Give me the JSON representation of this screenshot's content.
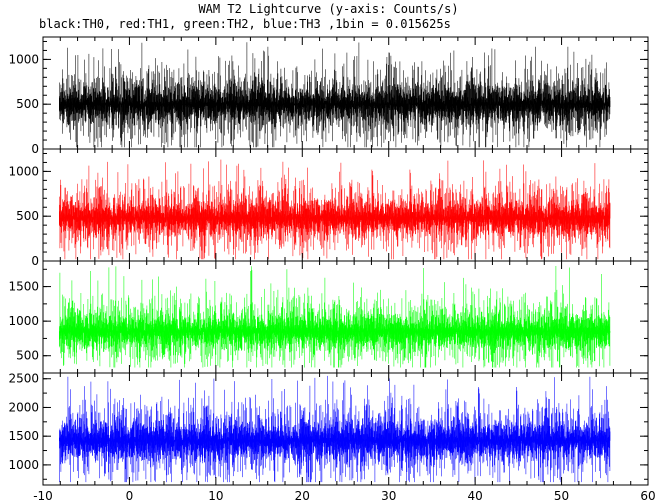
{
  "chart_data": {
    "type": "line",
    "title": "WAM T2 Lightcurve (y-axis: Counts/s)",
    "subtitle": "black:TH0, red:TH1, green:TH2, blue:TH3 ,1bin = 0.015625s",
    "xlim": [
      -10,
      60
    ],
    "x_ticks": [
      -10,
      0,
      10,
      20,
      30,
      40,
      50,
      60
    ],
    "x_data_range": [
      -8.1,
      55.6
    ],
    "grid": false,
    "panels": [
      {
        "name": "TH0",
        "color": "#000000",
        "ylim": [
          0,
          1250
        ],
        "y_ticks": [
          0,
          500,
          1000
        ],
        "mean": 500,
        "spread": 170,
        "spike_max": 1200,
        "spike_min": 20
      },
      {
        "name": "TH1",
        "color": "#ff0000",
        "ylim": [
          0,
          1250
        ],
        "y_ticks": [
          0,
          500,
          1000
        ],
        "mean": 480,
        "spread": 150,
        "spike_max": 1150,
        "spike_min": 20
      },
      {
        "name": "TH2",
        "color": "#00ff00",
        "ylim": [
          250,
          1870
        ],
        "y_ticks": [
          500,
          1000,
          1500
        ],
        "mean": 850,
        "spread": 200,
        "spike_max": 1800,
        "spike_min": 330
      },
      {
        "name": "TH3",
        "color": "#0000ff",
        "ylim": [
          650,
          2600
        ],
        "y_ticks": [
          1000,
          1500,
          2000,
          2500
        ],
        "mean": 1420,
        "spread": 260,
        "spike_max": 2580,
        "spike_min": 700
      }
    ]
  }
}
